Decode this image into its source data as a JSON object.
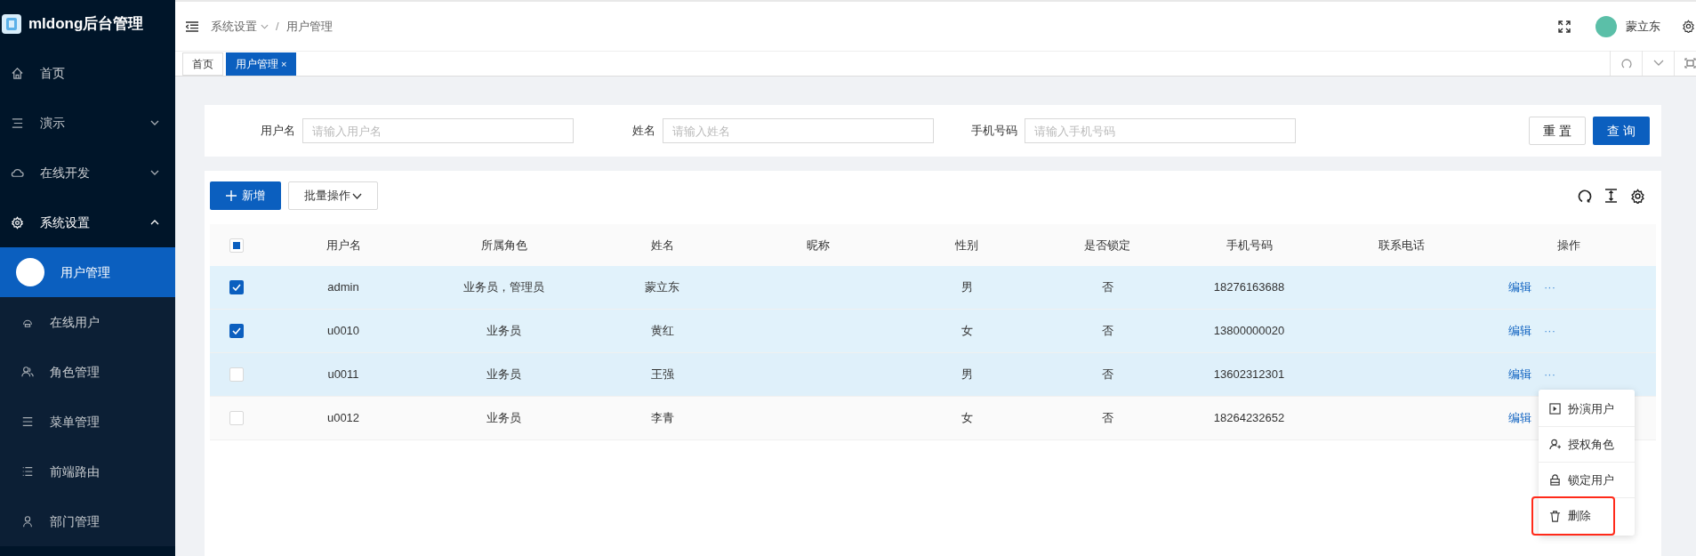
{
  "app": {
    "title": "mldong后台管理"
  },
  "sidebar": {
    "items": [
      {
        "label": "首页",
        "expandable": false,
        "expanded": false,
        "selected": false
      },
      {
        "label": "演示",
        "expandable": true,
        "expanded": false,
        "selected": false
      },
      {
        "label": "在线开发",
        "expandable": true,
        "expanded": false,
        "selected": false
      },
      {
        "label": "系统设置",
        "expandable": true,
        "expanded": true,
        "selected": false,
        "children": [
          {
            "label": "用户管理",
            "selected": true
          },
          {
            "label": "在线用户",
            "selected": false
          },
          {
            "label": "角色管理",
            "selected": false
          },
          {
            "label": "菜单管理",
            "selected": false
          },
          {
            "label": "前端路由",
            "selected": false
          },
          {
            "label": "部门管理",
            "selected": false
          }
        ]
      }
    ]
  },
  "header": {
    "breadcrumb": [
      "系统设置",
      "用户管理"
    ],
    "breadcrumb_separator": "/",
    "user_name": "蒙立东"
  },
  "tabs": [
    {
      "label": "首页",
      "selected": false,
      "closable": false
    },
    {
      "label": "用户管理",
      "selected": true,
      "closable": true
    }
  ],
  "tab_close": "×",
  "filters": [
    {
      "label": "用户名",
      "placeholder": "请输入用户名"
    },
    {
      "label": "姓名",
      "placeholder": "请输入姓名"
    },
    {
      "label": "手机号码",
      "placeholder": "请输入手机号码"
    }
  ],
  "filter_buttons": [
    {
      "label": "重 置",
      "primary": false
    },
    {
      "label": "查 询",
      "primary": true
    }
  ],
  "toolbar": {
    "add": "新增",
    "batch": "批量操作"
  },
  "table": {
    "select_all_indeterminate": true,
    "columns": [
      "用户名",
      "所属角色",
      "姓名",
      "昵称",
      "性别",
      "是否锁定",
      "手机号码",
      "联系电话",
      "操作"
    ],
    "rows": [
      {
        "selected": true,
        "hovered": false,
        "cells": [
          "admin",
          "业务员，管理员",
          "蒙立东",
          "",
          "男",
          "否",
          "18276163688",
          ""
        ],
        "actions": [
          "编辑",
          "···"
        ]
      },
      {
        "selected": true,
        "hovered": false,
        "cells": [
          "u0010",
          "业务员",
          "黄红",
          "",
          "女",
          "否",
          "13800000020",
          ""
        ],
        "actions": [
          "编辑",
          "···"
        ]
      },
      {
        "selected": false,
        "hovered": true,
        "cells": [
          "u0011",
          "业务员",
          "王强",
          "",
          "男",
          "否",
          "13602312301",
          ""
        ],
        "actions": [
          "编辑",
          "···"
        ]
      },
      {
        "selected": false,
        "hovered": false,
        "cells": [
          "u0012",
          "业务员",
          "李青",
          "",
          "女",
          "否",
          "18264232652",
          ""
        ],
        "actions": [
          "编辑"
        ]
      }
    ]
  },
  "dropdown": {
    "items": [
      {
        "label": "扮演用户",
        "annotated": false
      },
      {
        "label": "授权角色",
        "annotated": false
      },
      {
        "label": "锁定用户",
        "annotated": false
      },
      {
        "label": "删除",
        "annotated": true
      }
    ]
  }
}
